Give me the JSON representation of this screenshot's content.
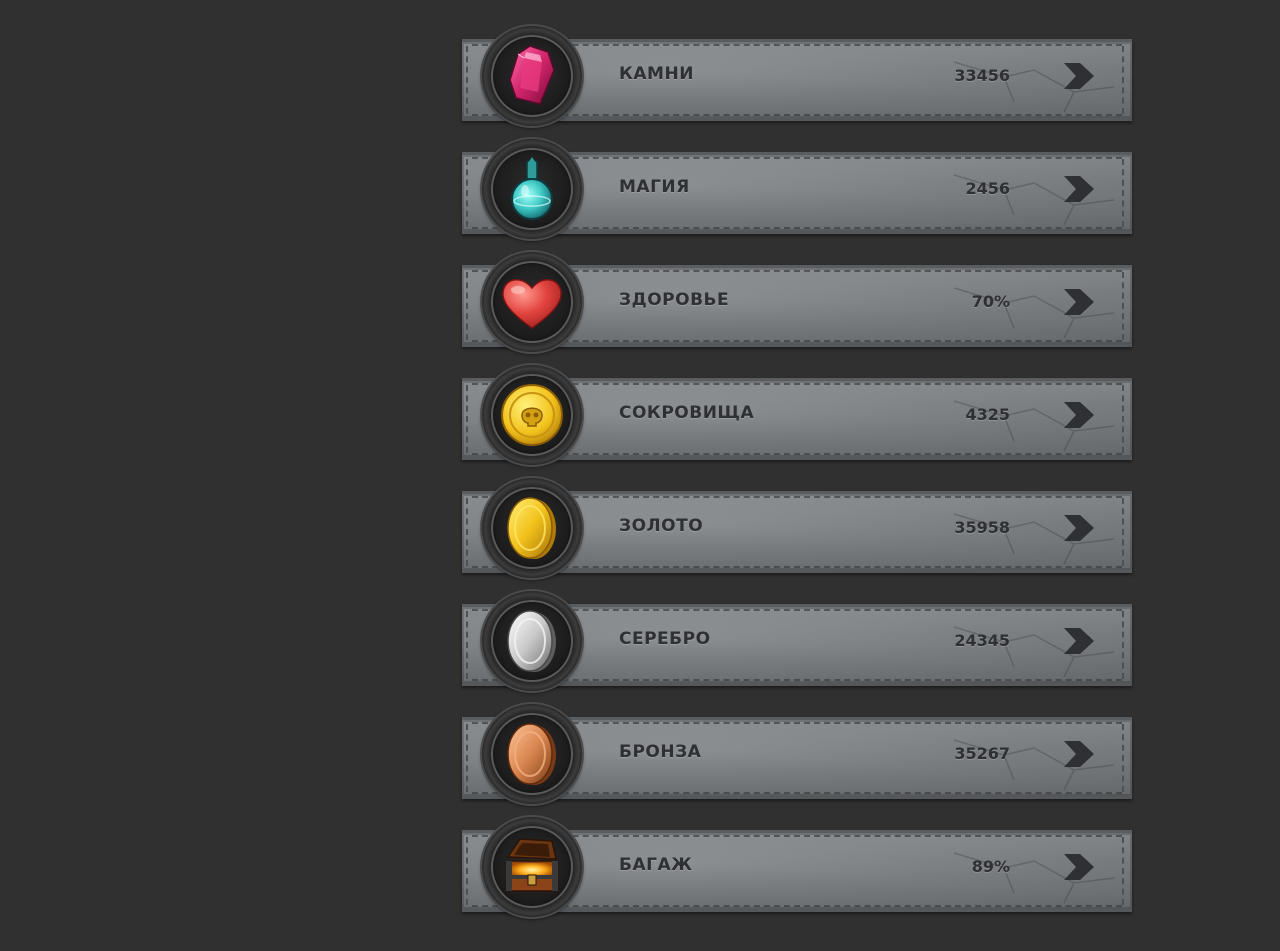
{
  "resources": [
    {
      "id": "stones",
      "label": "КАМНИ",
      "value": "33456",
      "icon": "gem-icon"
    },
    {
      "id": "magic",
      "label": "МАГИЯ",
      "value": "2456",
      "icon": "potion-icon"
    },
    {
      "id": "health",
      "label": "ЗДОРОВЬЕ",
      "value": "70%",
      "icon": "heart-icon"
    },
    {
      "id": "treasures",
      "label": "СОКРОВИЩА",
      "value": "4325",
      "icon": "skull-coin-icon"
    },
    {
      "id": "gold",
      "label": "ЗОЛОТО",
      "value": "35958",
      "icon": "gold-coin-icon"
    },
    {
      "id": "silver",
      "label": "СЕРЕБРО",
      "value": "24345",
      "icon": "silver-coin-icon"
    },
    {
      "id": "bronze",
      "label": "БРОНЗА",
      "value": "35267",
      "icon": "bronze-coin-icon"
    },
    {
      "id": "luggage",
      "label": "БАГАЖ",
      "value": "89%",
      "icon": "treasure-chest-icon"
    }
  ],
  "colors": {
    "background": "#303030",
    "bar": "#7d8184",
    "text": "#2e3033",
    "gem": "#d0246a",
    "potion": "#3ec8c4",
    "heart": "#e2443f",
    "gold": "#f2c21b",
    "silver": "#c9c9c9",
    "bronze": "#d9864f"
  }
}
